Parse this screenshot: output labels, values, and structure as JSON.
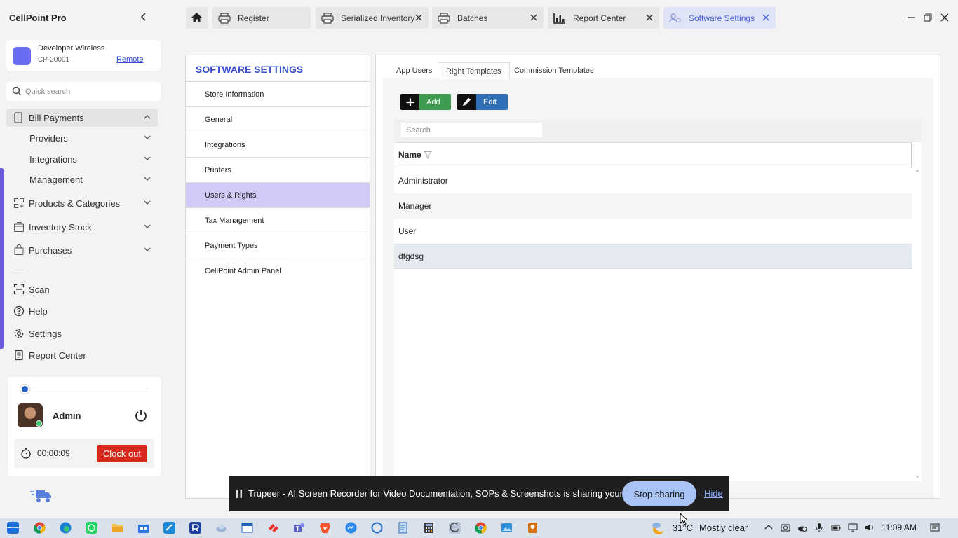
{
  "app": {
    "title": "CellPoint Pro",
    "store": {
      "name": "Developer Wireless",
      "id": "CP-20001",
      "remote_label": "Remote"
    },
    "quick_search_placeholder": "Quick search"
  },
  "sidebar": {
    "items": [
      {
        "label": "Bill Payments",
        "icon": "receipt-icon",
        "expanded": true
      },
      {
        "label": "Providers",
        "sub": true
      },
      {
        "label": "Integrations",
        "sub": true
      },
      {
        "label": "Management",
        "sub": true
      },
      {
        "label": "Products & Categories",
        "icon": "grid-plus-icon"
      },
      {
        "label": "Inventory Stock",
        "icon": "box-icon"
      },
      {
        "label": "Purchases",
        "icon": "bag-icon"
      }
    ],
    "tools": [
      {
        "label": "Scan",
        "icon": "scan-icon"
      },
      {
        "label": "Help",
        "icon": "help-icon"
      },
      {
        "label": "Settings",
        "icon": "gear-icon"
      },
      {
        "label": "Report Center",
        "icon": "report-icon"
      }
    ],
    "user": {
      "name": "Admin",
      "timer": "00:00:09",
      "clock_out_label": "Clock out"
    }
  },
  "tabs": [
    {
      "label": "Register",
      "icon": "printer-icon"
    },
    {
      "label": "Serialized Inventory",
      "icon": "printer-icon"
    },
    {
      "label": "Batches",
      "icon": "printer-icon"
    },
    {
      "label": "Report Center",
      "icon": "bar-chart-icon"
    },
    {
      "label": "Software Settings",
      "icon": "settings-users-icon",
      "active": true
    }
  ],
  "settings": {
    "title": "SOFTWARE SETTINGS",
    "menu": [
      "Store Information",
      "General",
      "Integrations",
      "Printers",
      "Users & Rights",
      "Tax Management",
      "Payment Types",
      "CellPoint Admin Panel"
    ],
    "selected_menu": "Users & Rights"
  },
  "content": {
    "tabs": [
      "App Users",
      "Right Templates",
      "Commission Templates"
    ],
    "active_tab": "Right Templates",
    "add_label": "Add",
    "edit_label": "Edit",
    "search_placeholder": "Search",
    "column_header": "Name",
    "rows": [
      "Administrator",
      "Manager",
      "User",
      "dfgdsg"
    ],
    "selected_row": "dfgdsg"
  },
  "share_bar": {
    "text": "Trupeer - AI Screen Recorder for Video Documentation, SOPs & Screenshots is sharing your screen.",
    "stop_label": "Stop sharing",
    "hide_label": "Hide"
  },
  "taskbar": {
    "temperature": "31°C",
    "weather": "Mostly clear",
    "time": "11:09 AM"
  },
  "colors": {
    "accent": "#3a4fc8",
    "selected_menu": "#cfcaf6",
    "add": "#3f9b4f",
    "edit": "#2f6fb6",
    "clock_out": "#d8271d"
  }
}
